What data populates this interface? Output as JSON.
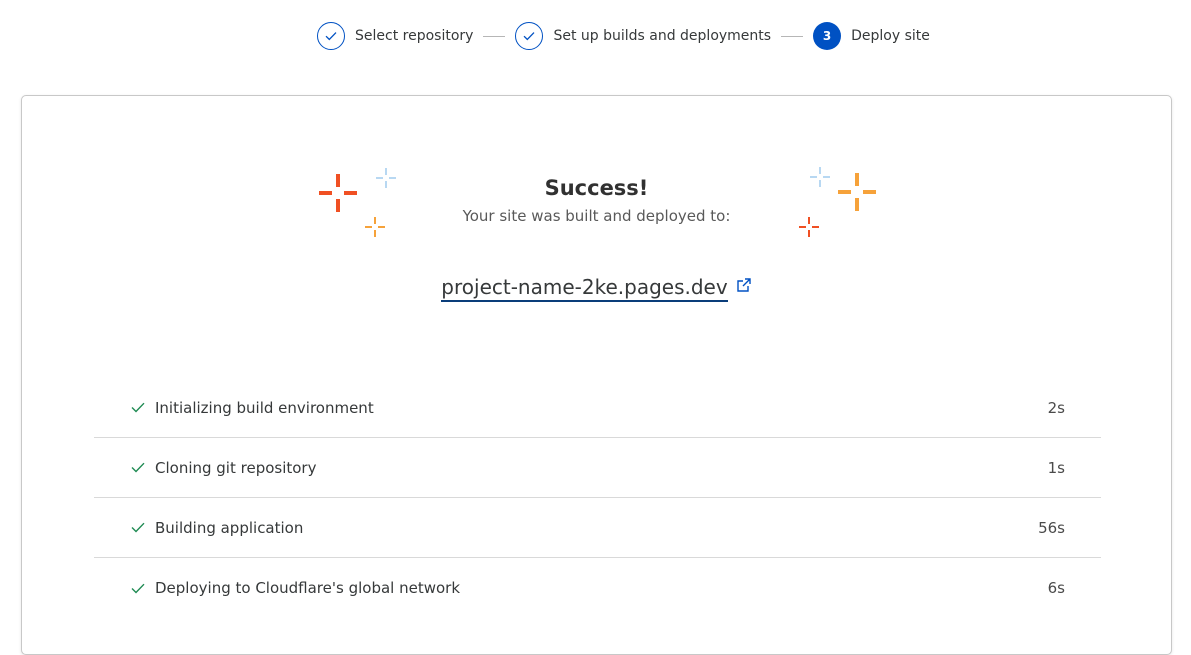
{
  "stepper": {
    "steps": [
      {
        "label": "Select repository",
        "state": "done",
        "icon": "check-icon"
      },
      {
        "label": "Set up builds and deployments",
        "state": "done",
        "icon": "check-icon"
      },
      {
        "label": "Deploy site",
        "state": "active",
        "number": "3"
      }
    ]
  },
  "result": {
    "title": "Success!",
    "subtitle": "Your site was built and deployed to:",
    "site_url": "project-name-2ke.pages.dev",
    "link_icon": "external-link-icon"
  },
  "build_steps": [
    {
      "label": "Initializing build environment",
      "duration": "2s",
      "status": "complete"
    },
    {
      "label": "Cloning git repository",
      "duration": "1s",
      "status": "complete"
    },
    {
      "label": "Building application",
      "duration": "56s",
      "status": "complete"
    },
    {
      "label": "Deploying to Cloudflare's global network",
      "duration": "6s",
      "status": "complete"
    }
  ],
  "colors": {
    "accent": "#0051c3",
    "success": "#1e8a52",
    "sparkle_red": "#f05023",
    "sparkle_orange": "#f6a23a",
    "sparkle_light_blue": "#b8d8f2"
  }
}
